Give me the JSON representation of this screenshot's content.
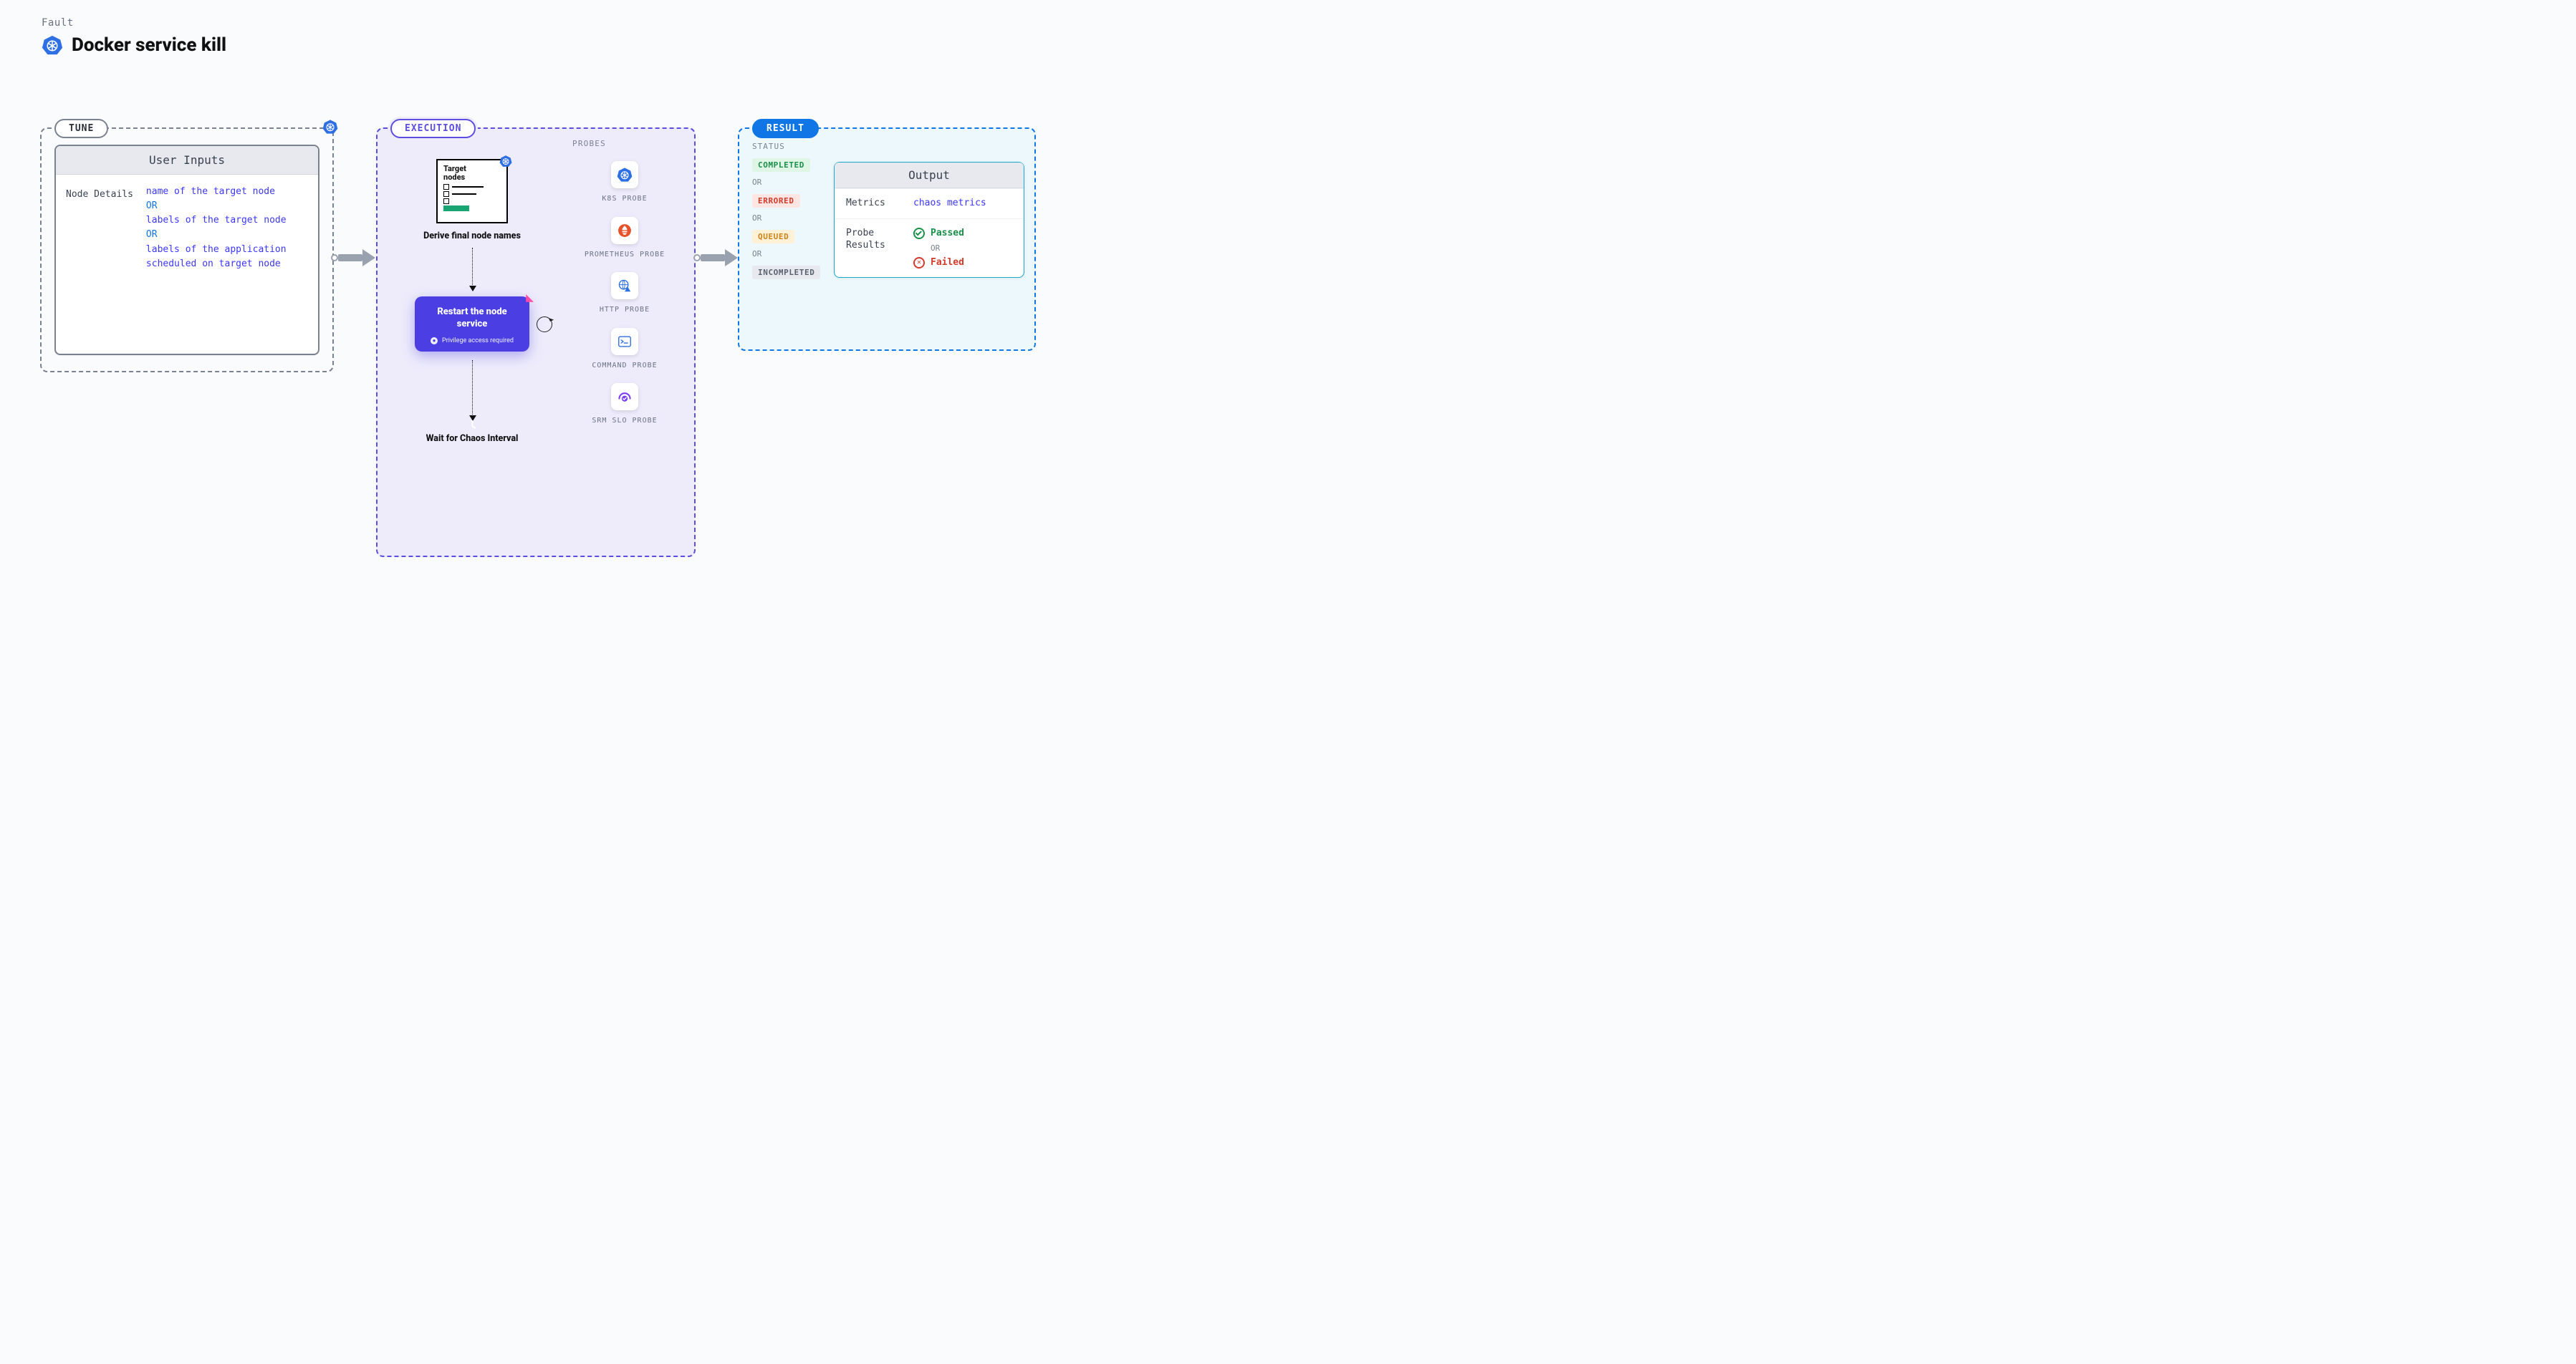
{
  "header": {
    "label": "Fault",
    "title": "Docker service kill"
  },
  "tune": {
    "badge": "TUNE",
    "card_title": "User Inputs",
    "left_label": "Node Details",
    "values": {
      "v1": "name of the target node",
      "or1": "OR",
      "v2": "labels of the target node",
      "or2": "OR",
      "v3": "labels of the application scheduled on target node"
    }
  },
  "execution": {
    "badge": "EXECUTION",
    "target_title_l1": "Target",
    "target_title_l2": "nodes",
    "step1": "Derive final node names",
    "restart_title": "Restart the node service",
    "restart_note": "Privilege access required",
    "step3": "Wait for Chaos Interval",
    "probes_title": "PROBES",
    "probes": [
      {
        "name": "k8s",
        "label": "K8S PROBE"
      },
      {
        "name": "prometheus",
        "label": "PROMETHEUS PROBE"
      },
      {
        "name": "http",
        "label": "HTTP PROBE"
      },
      {
        "name": "command",
        "label": "COMMAND PROBE"
      },
      {
        "name": "srm",
        "label": "SRM SLO PROBE"
      }
    ]
  },
  "result": {
    "badge": "RESULT",
    "status_title": "STATUS",
    "statuses": {
      "completed": "COMPLETED",
      "errored": "ERRORED",
      "queued": "QUEUED",
      "incompleted": "INCOMPLETED",
      "or": "OR"
    },
    "output": {
      "title": "Output",
      "metrics_key": "Metrics",
      "metrics_val": "chaos metrics",
      "probe_key_l1": "Probe",
      "probe_key_l2": "Results",
      "passed": "Passed",
      "failed": "Failed",
      "or": "OR"
    }
  }
}
